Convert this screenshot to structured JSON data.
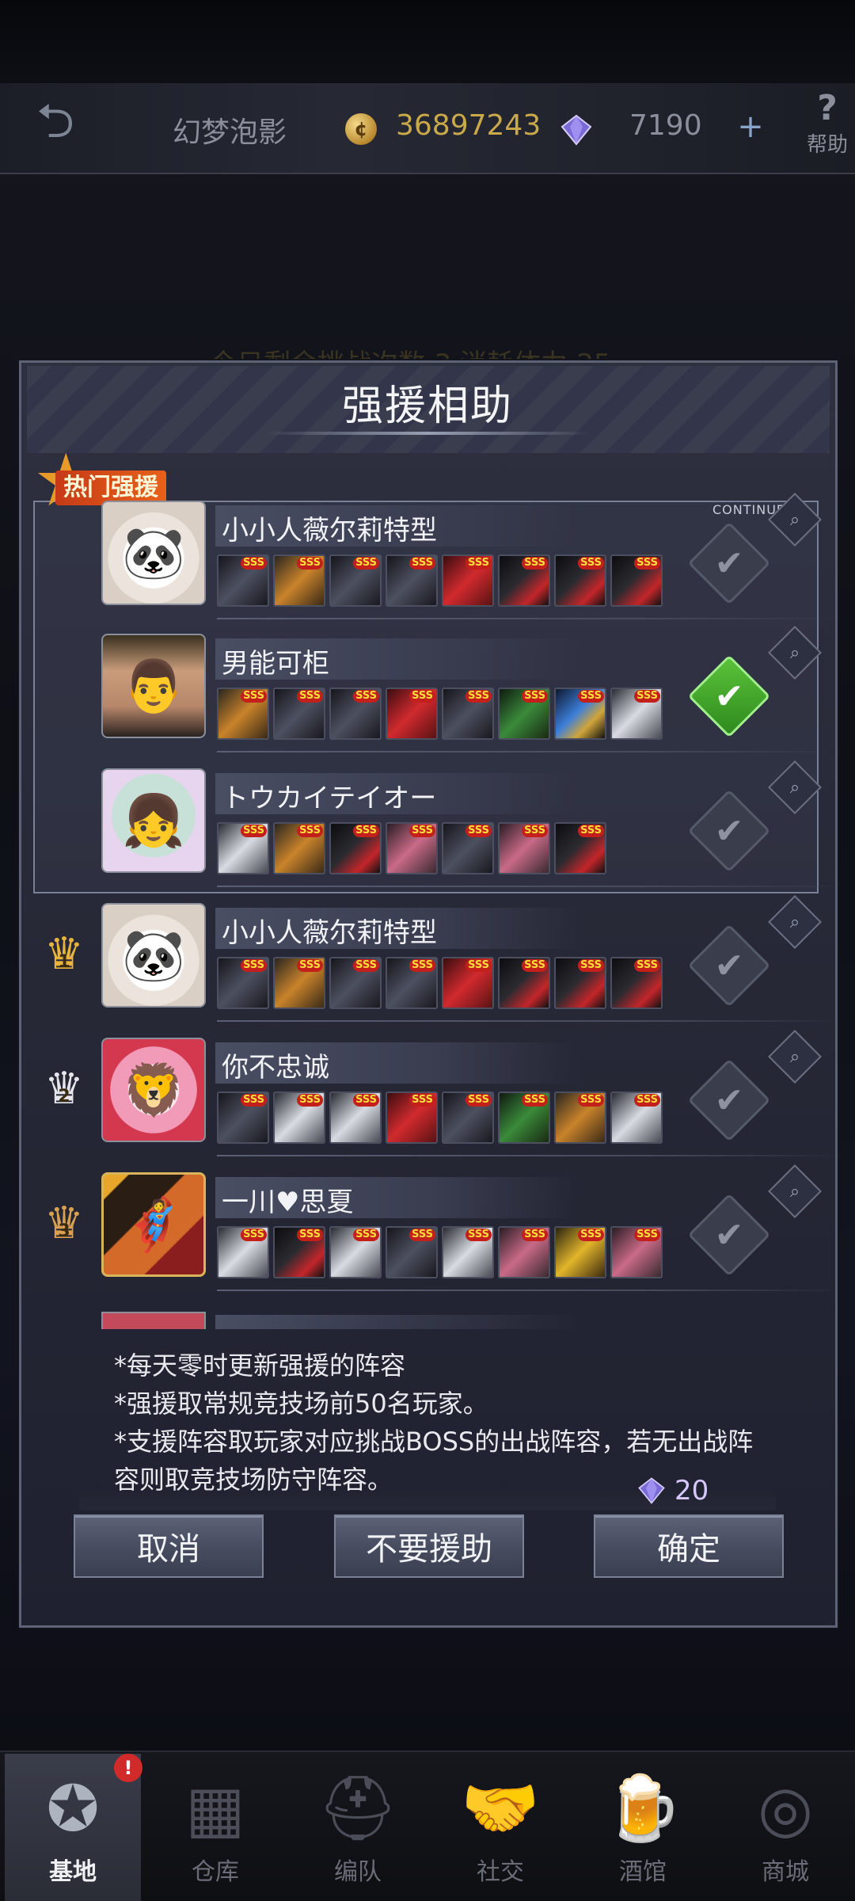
{
  "top_bar": {
    "player_name": "幻梦泡影",
    "coins": "36897243",
    "gems": "7190",
    "plus": "+",
    "help_label": "帮助",
    "help_symbol": "?"
  },
  "background_text": "今日剩余挑战次数:3  消耗体力:25",
  "dialog": {
    "title": "强援相助",
    "hot_label": "热门强援",
    "continue_tag": "CONTINUE...",
    "rows": [
      {
        "name": "小小人薇尔莉特型",
        "avatar": "panda",
        "selected": false,
        "rank": "",
        "units": [
          "u-dark",
          "u-gold",
          "u-dark",
          "u-dark",
          "u-red",
          "u-black-red",
          "u-black-red",
          "u-black-red"
        ]
      },
      {
        "name": "男能可柜",
        "avatar": "man",
        "selected": true,
        "rank": "",
        "units": [
          "u-gold",
          "u-dark",
          "u-dark",
          "u-red",
          "u-dark",
          "u-green",
          "u-blue",
          "u-white"
        ]
      },
      {
        "name": "トウカイテイオー",
        "avatar": "girl",
        "selected": false,
        "rank": "",
        "units": [
          "u-white",
          "u-gold",
          "u-black-red",
          "u-pink",
          "u-dark",
          "u-pink",
          "u-black-red"
        ]
      },
      {
        "name": "小小人薇尔莉特型",
        "avatar": "panda",
        "selected": false,
        "rank": "1",
        "units": [
          "u-dark",
          "u-gold",
          "u-dark",
          "u-dark",
          "u-red",
          "u-black-red",
          "u-black-red",
          "u-black-red"
        ]
      },
      {
        "name": "你不忠诚",
        "avatar": "pink",
        "selected": false,
        "rank": "2",
        "units": [
          "u-dark",
          "u-white",
          "u-white",
          "u-red",
          "u-dark",
          "u-green",
          "u-gold",
          "u-white"
        ]
      },
      {
        "name": "一川♥思夏",
        "avatar": "hero",
        "selected": false,
        "rank": "3",
        "units": [
          "u-white",
          "u-black-red",
          "u-white",
          "u-dark",
          "u-white",
          "u-pink",
          "u-yellow",
          "u-pink"
        ]
      }
    ],
    "notes": [
      "*每天零时更新强援的阵容",
      "*强援取常规竞技场前50名玩家。",
      "*支援阵容取玩家对应挑战BOSS的出战阵容，若无出战阵容则取竞技场防守阵容。"
    ],
    "cost": "20",
    "buttons": {
      "cancel": "取消",
      "no_help": "不要援助",
      "confirm": "确定"
    }
  },
  "unit_badge": "SSS",
  "bottom_nav": [
    {
      "label": "基地",
      "icon": "base-star-icon",
      "active": true
    },
    {
      "label": "仓库",
      "icon": "warehouse-icon",
      "active": false
    },
    {
      "label": "编队",
      "icon": "formation-helmet-icon",
      "active": false
    },
    {
      "label": "社交",
      "icon": "handshake-icon",
      "active": false
    },
    {
      "label": "酒馆",
      "icon": "tavern-mug-icon",
      "active": false
    },
    {
      "label": "商城",
      "icon": "shop-icon",
      "active": false
    }
  ],
  "nav_badge": "!",
  "colors": {
    "accent_green": "#4fb82f",
    "gold": "#c9a94a",
    "gem": "#d6c8ff"
  }
}
